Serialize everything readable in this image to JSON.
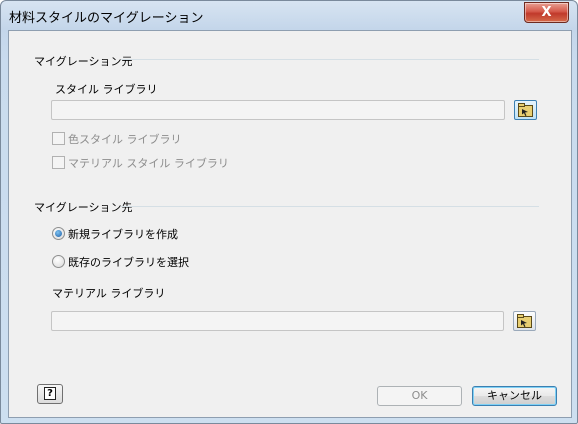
{
  "window": {
    "title": "材料スタイルのマイグレーション",
    "close_symbol": "X"
  },
  "source": {
    "header": "マイグレーション元",
    "style_library_label": "スタイル ライブラリ",
    "style_library_value": "",
    "checkbox_color_label": "色スタイル ライブラリ",
    "checkbox_material_label": "マテリアル スタイル ライブラリ",
    "checkbox_color_checked": false,
    "checkbox_material_checked": false
  },
  "destination": {
    "header": "マイグレーション先",
    "radio_new_label": "新規ライブラリを作成",
    "radio_existing_label": "既存のライブラリを選択",
    "selected": "new",
    "material_library_label": "マテリアル ライブラリ",
    "material_library_value": ""
  },
  "footer": {
    "help_symbol": "?",
    "ok_label": "OK",
    "cancel_label": "キャンセル"
  },
  "icons": {
    "close": "close-icon",
    "browse": "folder-browse-icon",
    "help": "help-icon"
  },
  "colors": {
    "close_button": "#c0392b",
    "disabled_text": "#8d8d8d",
    "radio_selected": "#1d5fa8"
  }
}
